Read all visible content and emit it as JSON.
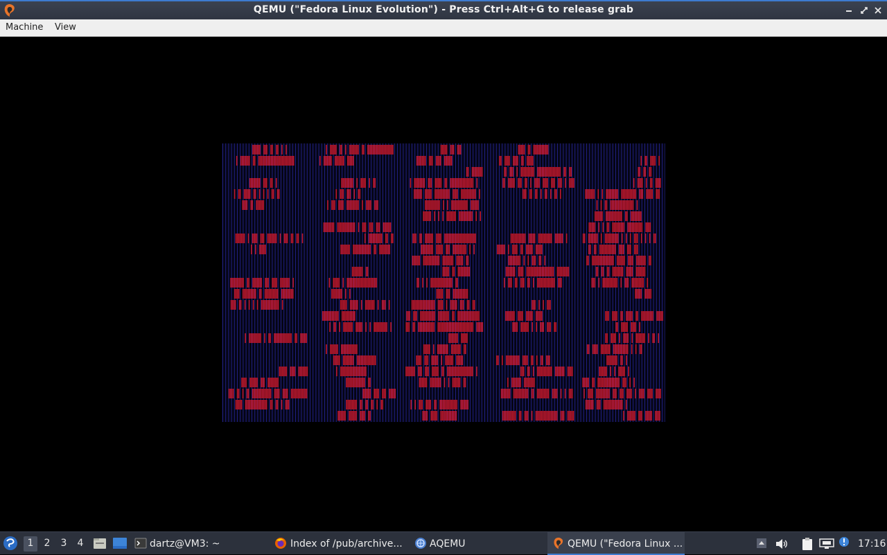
{
  "window": {
    "title": "QEMU (\"Fedora Linux Evolution\") - Press Ctrl+Alt+G to release grab"
  },
  "menubar": {
    "items": [
      {
        "label": "Machine"
      },
      {
        "label": "View"
      }
    ]
  },
  "guest_display": {
    "colors": {
      "background": "#000000",
      "stripes": "#2a2aa8",
      "blocks": "#c0182c"
    }
  },
  "taskbar": {
    "workspaces": [
      "1",
      "2",
      "3",
      "4"
    ],
    "active_workspace": "1",
    "tasks": [
      {
        "label": "dartz@VM3: ~",
        "icon": "terminal-icon"
      },
      {
        "label": "Index of /pub/archive...",
        "icon": "firefox-icon"
      },
      {
        "label": "AQEMU",
        "icon": "aqemu-icon"
      },
      {
        "label": "QEMU (\"Fedora Linux ...",
        "icon": "qemu-icon",
        "active": true
      }
    ],
    "clock": "17:16"
  },
  "colors": {
    "titlebar": "#2f3542",
    "accent": "#3d7bd0",
    "menubar": "#efefef",
    "taskbar": "#2c313c"
  }
}
